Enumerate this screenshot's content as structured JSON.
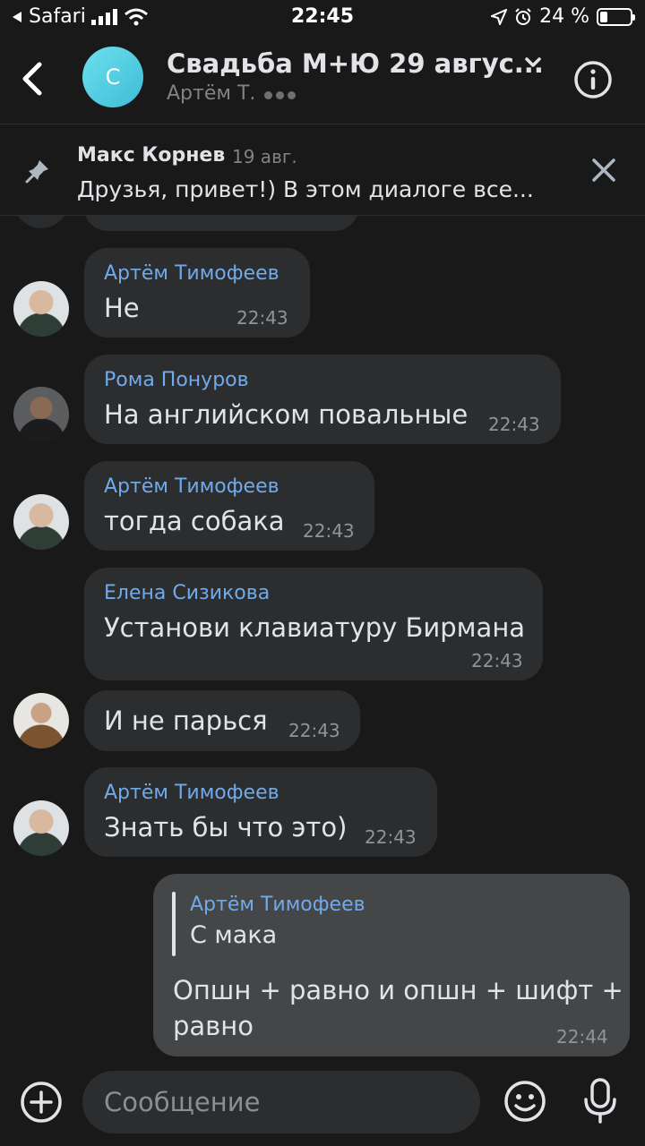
{
  "status_bar": {
    "carrier": "Safari",
    "time": "22:45",
    "battery_percent": "24 %"
  },
  "header": {
    "avatar_letter": "С",
    "title": "Свадьба М+Ю 29 авгус...",
    "typing": "Артём Т."
  },
  "pinned": {
    "author": "Макс Корнев",
    "date": "19 авг.",
    "text": "Друзья, привет!) В этом диалоге все..."
  },
  "messages": [
    {
      "sender": "Артём Тимофеев",
      "text": "Не",
      "time": "22:43"
    },
    {
      "sender": "Рома Понуров",
      "text": "На английском повальные",
      "time": "22:43"
    },
    {
      "sender": "Артём Тимофеев",
      "text": "тогда собака",
      "time": "22:43"
    },
    {
      "sender": "Елена Сизикова",
      "text": "Установи клавиатуру Бирмана",
      "time": "22:43"
    },
    {
      "sender": "",
      "text": "И не парься",
      "time": "22:43"
    },
    {
      "sender": "Артём Тимофеев",
      "text": "Знать бы что это)",
      "time": "22:43"
    }
  ],
  "own_message": {
    "reply_sender": "Артём Тимофеев",
    "reply_text": "С мака",
    "line1": "Опшн + равно и опшн + шифт +",
    "line2": "равно",
    "time": "22:44"
  },
  "composer": {
    "placeholder": "Сообщение"
  },
  "colors": {
    "accent": "#71aaeb",
    "bubble": "#2c2d2e",
    "background": "#19191a"
  }
}
